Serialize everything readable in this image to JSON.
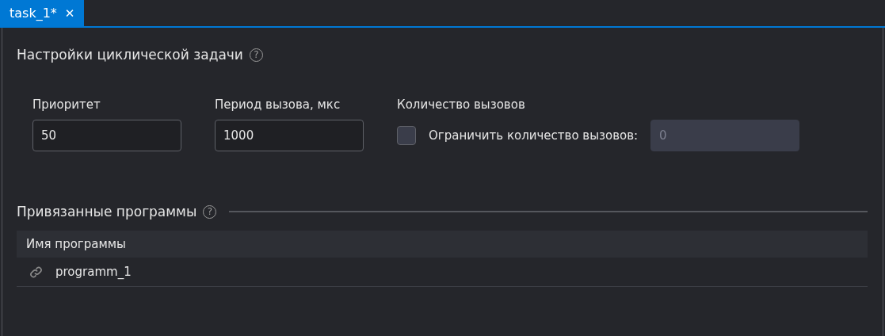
{
  "tabs": [
    {
      "label": "task_1*",
      "selected": true,
      "close": "✕"
    }
  ],
  "settings": {
    "title": "Настройки циклической задачи",
    "help": "?",
    "fields": [
      {
        "label": "Приоритет",
        "value": "50"
      },
      {
        "label": "Период вызова, мкс",
        "value": "1000"
      }
    ],
    "calls": {
      "label": "Количество вызовов",
      "checkbox_label": "Ограничить количество вызовов:",
      "checked": false,
      "value": "0",
      "disabled": true
    }
  },
  "programs": {
    "title": "Привязанные программы",
    "help": "?",
    "columns": [
      "Имя программы"
    ],
    "rows": [
      {
        "name": "programm_1"
      }
    ]
  }
}
